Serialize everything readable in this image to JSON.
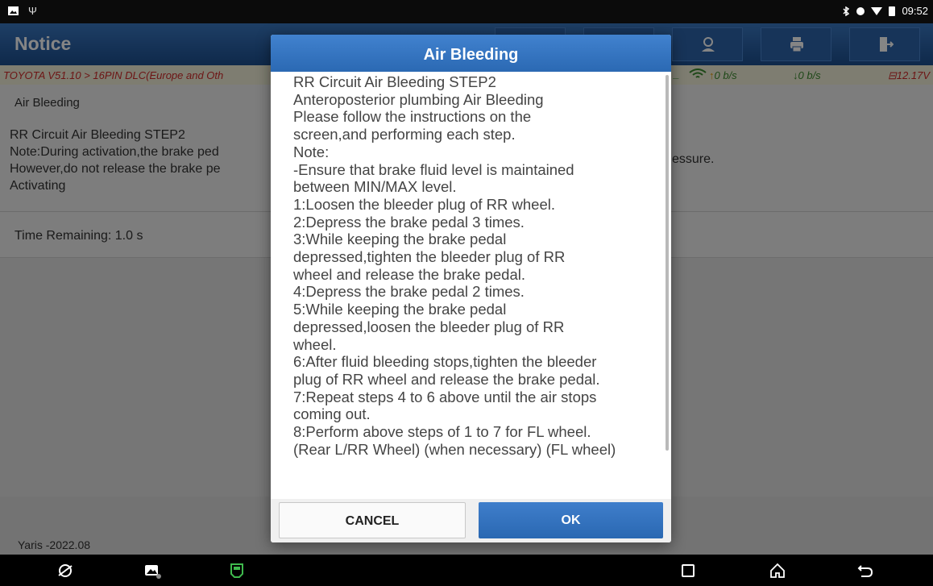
{
  "status_bar": {
    "time": "09:52",
    "usb_symbol": "Ψ"
  },
  "header": {
    "title": "Notice",
    "icons": [
      "generic-icon",
      "generic-icon",
      "user-icon",
      "print-icon",
      "exit-icon"
    ]
  },
  "info_bar": {
    "path": "TOYOTA V51.10 > 16PIN DLC(Europe and Oth",
    "upload_rate": "0 b/s",
    "download_rate": "0 b/s",
    "voltage": "⊟12.17V",
    "up_arrow": "↑",
    "down_arrow": "↓",
    "dash": "_"
  },
  "page": {
    "function_title": "Air Bleeding",
    "notes_lines": [
      "RR Circuit Air Bleeding STEP2",
      "Note:During activation,the brake ped",
      "However,do not release the brake pe",
      "Activating"
    ],
    "notes_continuation": "essure.",
    "time_remaining": "Time Remaining: 1.0 s",
    "model": "Yaris -2022.08"
  },
  "dialog": {
    "title": "Air Bleeding",
    "lines": [
      "RR Circuit Air Bleeding STEP2",
      "Anteroposterior plumbing Air Bleeding",
      "Please follow the instructions on the",
      "screen,and performing each step.",
      "Note:",
      "-Ensure that brake fluid level is maintained",
      "between MIN/MAX level.",
      "1:Loosen the bleeder plug of RR wheel.",
      "2:Depress the brake pedal 3 times.",
      "3:While keeping the brake pedal",
      "depressed,tighten the bleeder plug of RR",
      "wheel and release the brake pedal.",
      "4:Depress the brake pedal 2 times.",
      "5:While keeping the brake pedal",
      "depressed,loosen the bleeder plug of RR",
      "wheel.",
      "6:After fluid bleeding stops,tighten the bleeder",
      "plug of RR wheel and release the brake pedal.",
      "7:Repeat steps 4 to 6 above until the air stops",
      "coming out.",
      "8:Perform above steps of 1 to 7 for FL wheel.",
      "(Rear L/RR Wheel) (when necessary) (FL wheel)"
    ],
    "cancel_label": "CANCEL",
    "ok_label": "OK"
  },
  "nav_bar": {
    "items": [
      "browser-icon",
      "gallery-icon",
      "vci-icon",
      "recent-apps-icon",
      "home-icon",
      "back-icon"
    ]
  }
}
